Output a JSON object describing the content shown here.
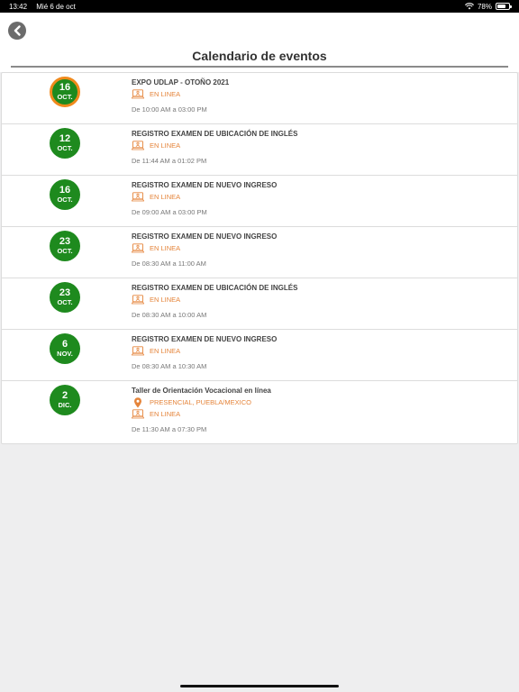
{
  "status_bar": {
    "time": "13:42",
    "date": "Mié 6 de oct",
    "battery": "78%",
    "battery_level": 0.78
  },
  "header": {
    "title": "Calendario de eventos",
    "back_icon": "chevron-left-icon"
  },
  "colors": {
    "badge": "#1e8a1e",
    "badge_highlight_ring": "#f08a1c",
    "location_text": "#e5843a"
  },
  "events": [
    {
      "day": "16",
      "month": "OCT.",
      "highlight": true,
      "title": "EXPO UDLAP - OTOÑO 2021",
      "locations": [
        {
          "type": "online",
          "label": "EN LINEA"
        }
      ],
      "time": "De 10:00 AM a 03:00 PM"
    },
    {
      "day": "12",
      "month": "OCT.",
      "highlight": false,
      "title": "REGISTRO EXAMEN DE UBICACIÓN DE INGLÉS",
      "locations": [
        {
          "type": "online",
          "label": "EN LINEA"
        }
      ],
      "time": "De 11:44 AM a 01:02 PM"
    },
    {
      "day": "16",
      "month": "OCT.",
      "highlight": false,
      "title": "REGISTRO EXAMEN DE NUEVO INGRESO",
      "locations": [
        {
          "type": "online",
          "label": "EN LINEA"
        }
      ],
      "time": "De 09:00 AM a 03:00 PM"
    },
    {
      "day": "23",
      "month": "OCT.",
      "highlight": false,
      "title": "REGISTRO EXAMEN DE NUEVO INGRESO",
      "locations": [
        {
          "type": "online",
          "label": "EN LINEA"
        }
      ],
      "time": "De 08:30 AM a 11:00 AM"
    },
    {
      "day": "23",
      "month": "OCT.",
      "highlight": false,
      "title": "REGISTRO EXAMEN DE UBICACIÓN DE INGLÉS",
      "locations": [
        {
          "type": "online",
          "label": "EN LINEA"
        }
      ],
      "time": "De 08:30 AM a 10:00 AM"
    },
    {
      "day": "6",
      "month": "NOV.",
      "highlight": false,
      "title": "REGISTRO EXAMEN DE NUEVO INGRESO",
      "locations": [
        {
          "type": "online",
          "label": "EN LINEA"
        }
      ],
      "time": "De 08:30 AM a 10:30 AM"
    },
    {
      "day": "2",
      "month": "DIC.",
      "highlight": false,
      "title": "Taller de Orientación Vocacional en línea",
      "locations": [
        {
          "type": "presencial",
          "label": "PRESENCIAL, PUEBLA/MEXICO"
        },
        {
          "type": "online",
          "label": "EN LINEA"
        }
      ],
      "time": "De 11:30 AM a 07:30 PM"
    }
  ]
}
